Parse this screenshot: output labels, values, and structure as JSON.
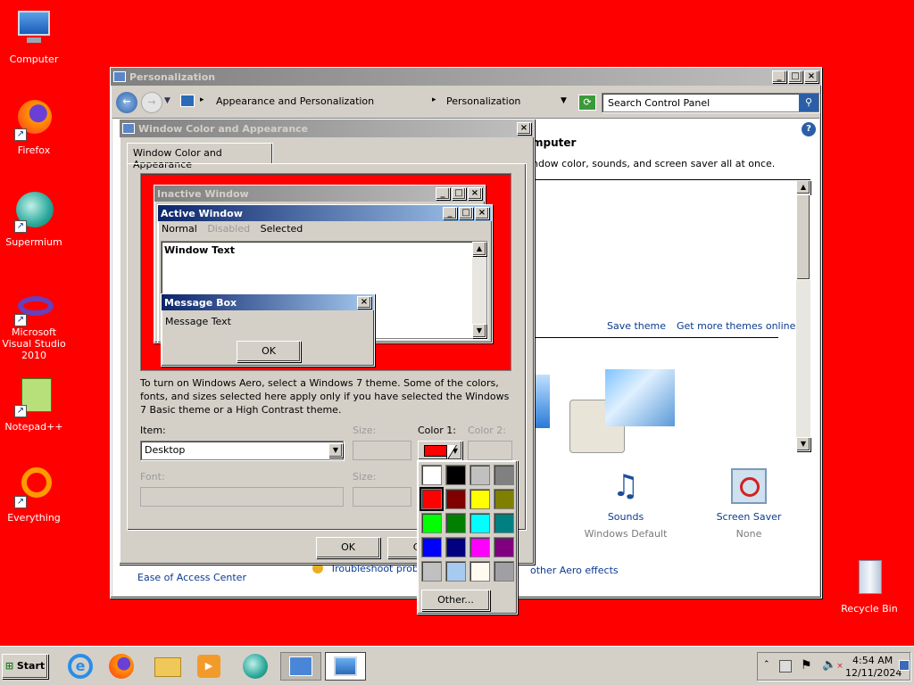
{
  "desktop": {
    "icons": [
      {
        "label": "Computer"
      },
      {
        "label": "Firefox"
      },
      {
        "label": "Supermium"
      },
      {
        "label": "Microsoft Visual Studio 2010"
      },
      {
        "label": "Notepad++"
      },
      {
        "label": "Everything"
      },
      {
        "label": "Recycle Bin"
      }
    ]
  },
  "personalization": {
    "title": "Personalization",
    "breadcrumb": [
      "Appearance and Personalization",
      "Personalization"
    ],
    "search_placeholder": "Search Control Panel",
    "heading_partial": "mputer",
    "description_partial": "ndow color, sounds, and screen saver all at once.",
    "save_theme": "Save theme",
    "get_more_themes": "Get more themes online",
    "sounds_label": "Sounds",
    "sounds_value": "Windows Default",
    "screensaver_label": "Screen Saver",
    "screensaver_value": "None",
    "ease_of_access": "Ease of Access Center",
    "troubleshoot_partial": "Troubleshoot problem",
    "aero_partial": "other Aero effects"
  },
  "dialog": {
    "title": "Window Color and Appearance",
    "tab": "Window Color and Appearance",
    "preview": {
      "inactive_title": "Inactive Window",
      "active_title": "Active Window",
      "menu_normal": "Normal",
      "menu_disabled": "Disabled",
      "menu_selected": "Selected",
      "window_text": "Window Text",
      "msgbox_title": "Message Box",
      "msgbox_text": "Message Text",
      "msgbox_ok": "OK"
    },
    "info": "To turn on Windows Aero, select a Windows 7 theme.  Some of the colors, fonts, and sizes selected here apply only if you have selected the Windows 7 Basic theme or a High Contrast theme.",
    "item_label": "Item:",
    "item_value": "Desktop",
    "size_label": "Size:",
    "color1_label": "Color 1:",
    "color2_label": "Color 2:",
    "font_label": "Font:",
    "size2_label": "Size:",
    "ok": "OK",
    "cancel_partial": "Ca"
  },
  "color_picker": {
    "colors": [
      "#ffffff",
      "#000000",
      "#c0c0c0",
      "#808080",
      "#ff0000",
      "#800000",
      "#ffff00",
      "#808000",
      "#00ff00",
      "#008000",
      "#00ffff",
      "#008080",
      "#0000ff",
      "#000080",
      "#ff00ff",
      "#800080",
      "#c0c0c0",
      "#a6caf0",
      "#fffbf0",
      "#a0a0a4"
    ],
    "selected_index": 4,
    "other_label": "Other..."
  },
  "taskbar": {
    "start": "Start",
    "time": "4:54 AM",
    "date": "12/11/2024"
  }
}
